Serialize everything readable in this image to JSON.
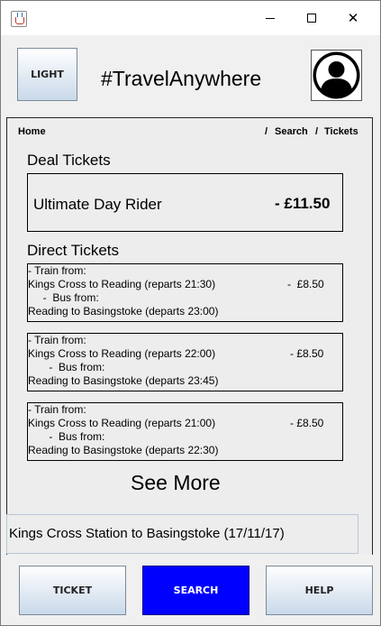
{
  "window": {
    "close_glyph": "✕"
  },
  "header": {
    "theme_button": "LIGHT",
    "brand": "#TravelAnywhere",
    "avatar_icon": "user-avatar-icon"
  },
  "breadcrumb": {
    "home": "Home",
    "sep1": "/",
    "search": "Search",
    "sep2": "/",
    "tickets": "Tickets"
  },
  "deal": {
    "heading": "Deal Tickets",
    "name": "Ultimate Day Rider",
    "price": "- £11.50"
  },
  "direct": {
    "heading": "Direct Tickets",
    "tickets": [
      {
        "train_label": "- Train from:",
        "train_route": "Kings Cross to Reading (reparts 21:30)",
        "price": "-  £8.50",
        "bus_label": "     -  Bus from:",
        "bus_route": "Reading to Basingstoke (departs 23:00)"
      },
      {
        "train_label": "- Train from:",
        "train_route": "Kings Cross to Reading (reparts 22:00)",
        "price": "- £8.50",
        "bus_label": "       -  Bus from:",
        "bus_route": "Reading to Basingstoke (departs 23:45)"
      },
      {
        "train_label": "- Train from:",
        "train_route": "Kings Cross to Reading (reparts 21:00)",
        "price": "- £8.50",
        "bus_label": "       -  Bus from:",
        "bus_route": "Reading to Basingstoke (departs 22:30)"
      }
    ]
  },
  "see_more": "See More",
  "route_summary": "Kings Cross Station to Basingstoke (17/11/17)",
  "nav": {
    "ticket": "TICKET",
    "search": "SEARCH",
    "help": "HELP",
    "active": "search",
    "active_color": "#0000ff"
  }
}
